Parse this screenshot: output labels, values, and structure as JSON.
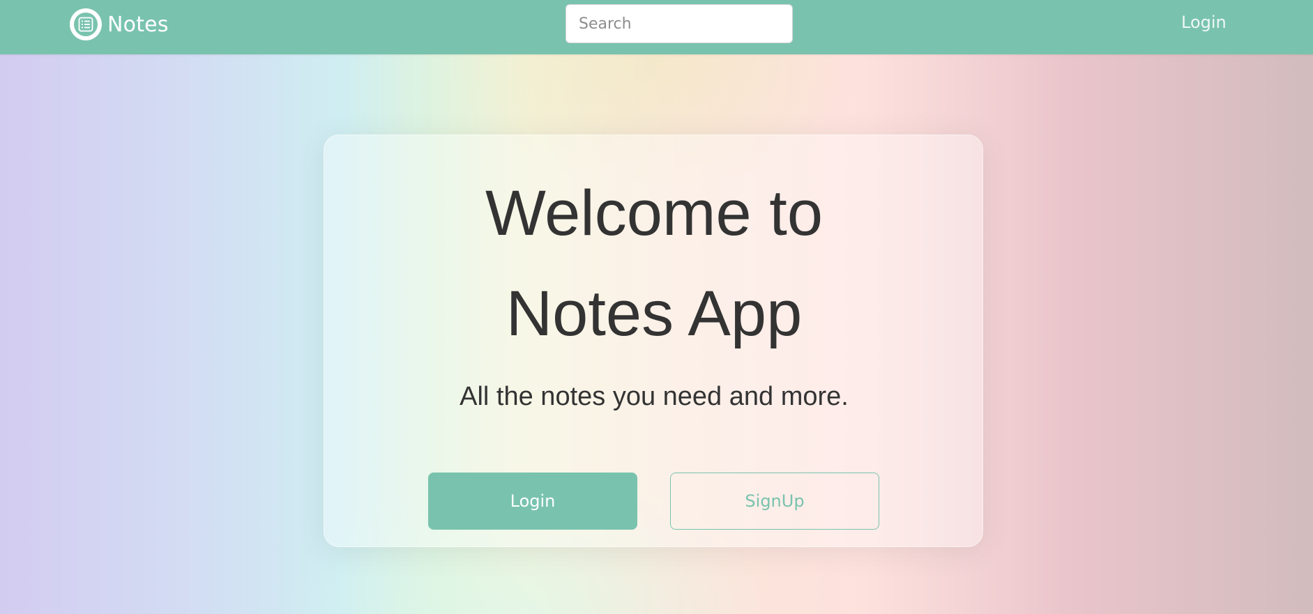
{
  "navbar": {
    "brand_name": "Notes",
    "brand_icon": "list-icon",
    "search_placeholder": "Search",
    "search_value": "",
    "login_label": "Login"
  },
  "hero": {
    "title_line1": "Welcome to",
    "title_line2": "Notes App",
    "tagline": "All the notes you need and more.",
    "login_button_label": "Login",
    "signup_button_label": "SignUp"
  },
  "colors": {
    "accent": "#79c3ae",
    "text": "#333333",
    "white": "#ffffff"
  }
}
